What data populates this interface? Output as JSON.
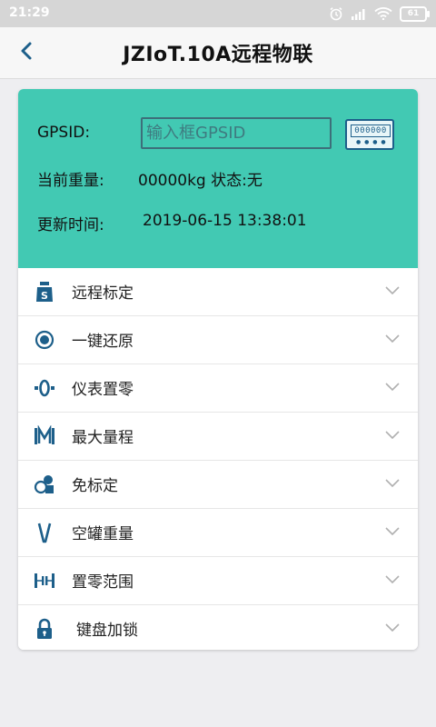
{
  "status_bar": {
    "time": "21:29",
    "battery": "61"
  },
  "header": {
    "title": "JZIoT.10A远程物联"
  },
  "panel": {
    "gps_label": "GPSID:",
    "gps_placeholder": "输入框GPSID",
    "scanner_digits": "000000",
    "weight_label": "当前重量:",
    "weight_value": "00000kg 状态:无",
    "update_label": "更新时间:",
    "update_value": "2019-06-15 13:38:01",
    "bg_color": "#42c9b3"
  },
  "menu": {
    "items": [
      {
        "label": "远程标定",
        "icon": "weight-icon"
      },
      {
        "label": "一键还原",
        "icon": "radio-dot-icon"
      },
      {
        "label": "仪表置零",
        "icon": "zero-icon"
      },
      {
        "label": "最大量程",
        "icon": "max-range-icon"
      },
      {
        "label": "免标定",
        "icon": "shapes-icon"
      },
      {
        "label": "空罐重量",
        "icon": "tank-icon"
      },
      {
        "label": "置零范围",
        "icon": "range-icon"
      },
      {
        "label": "键盘加锁",
        "icon": "lock-icon"
      }
    ]
  },
  "colors": {
    "accent": "#1d5f8a",
    "teal": "#42c9b3"
  }
}
